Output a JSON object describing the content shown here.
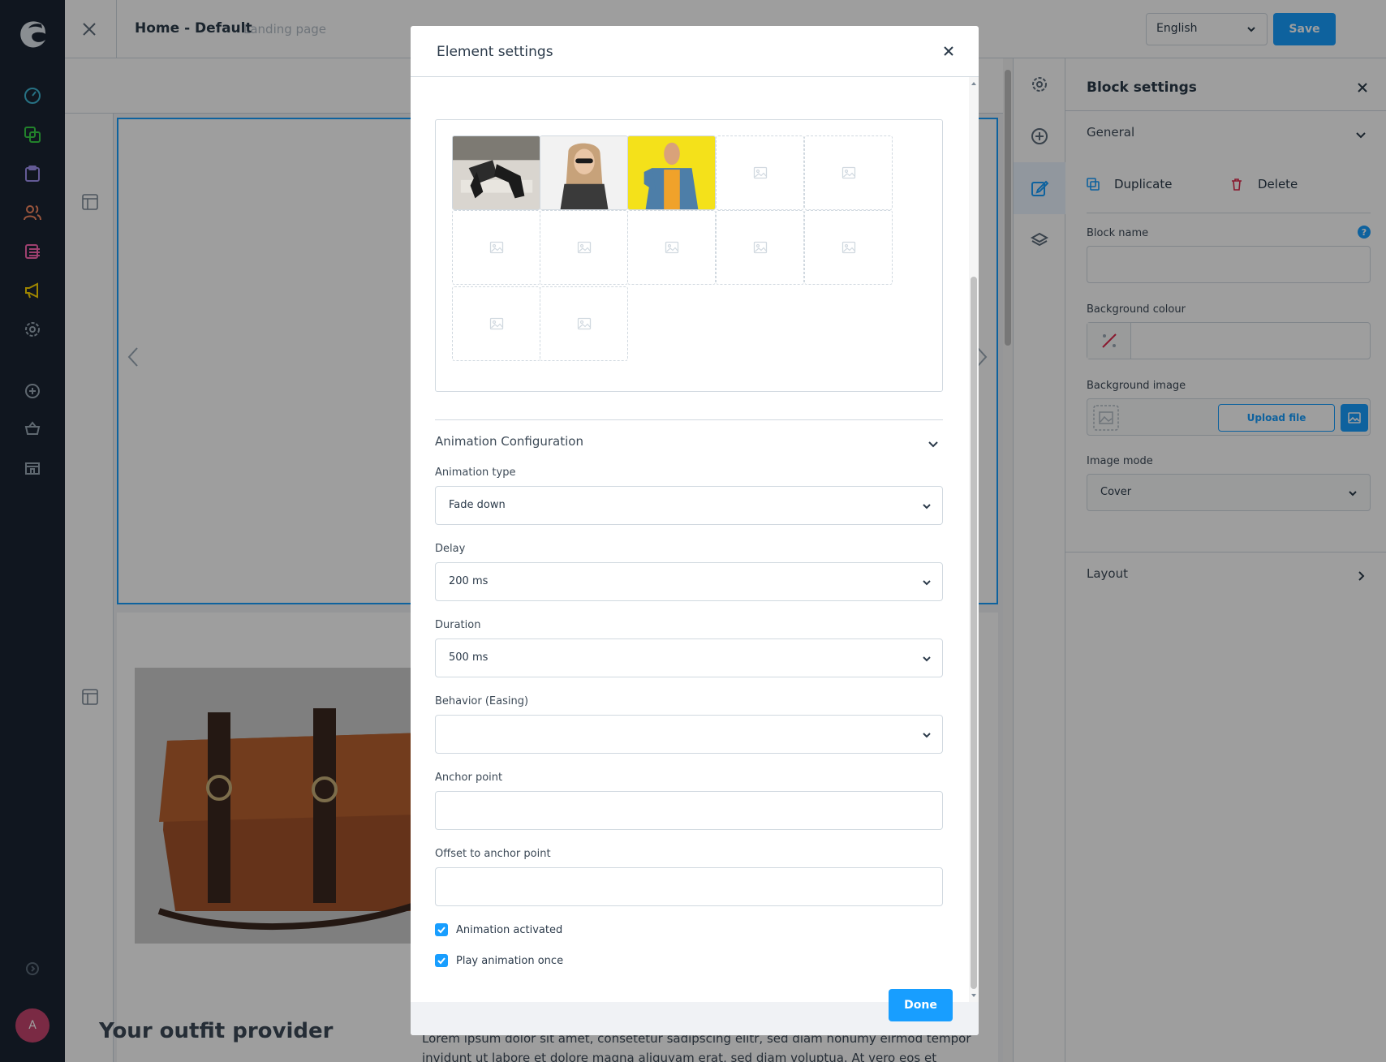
{
  "header": {
    "page_title": "Home - Default",
    "page_type": "Landing page",
    "language": "English",
    "save_label": "Save"
  },
  "sidebar": {
    "avatar_initial": "A",
    "icons": [
      "dashboard-icon",
      "catalogue-icon",
      "orders-icon",
      "customers-icon",
      "content-icon",
      "marketing-icon",
      "settings-icon",
      "add-icon",
      "basket-icon",
      "store-icon",
      "help-icon"
    ]
  },
  "canvas": {
    "heading": "Your outfit provider",
    "paragraph": "Lorem ipsum dolor sit amet, consetetur sadipscing elitr, sed diam nonumy eirmod tempor invidunt ut labore et dolore magna aliquyam erat, sed diam voluptua. At vero eos et accusam et justo duo"
  },
  "block_settings": {
    "title": "Block settings",
    "general_label": "General",
    "duplicate_label": "Duplicate",
    "delete_label": "Delete",
    "block_name_label": "Block name",
    "block_name_value": "",
    "background_colour_label": "Background colour",
    "background_image_label": "Background image",
    "upload_label": "Upload file",
    "image_mode_label": "Image mode",
    "image_mode_value": "Cover",
    "layout_label": "Layout"
  },
  "modal": {
    "title": "Element settings",
    "gallery": {
      "slots": [
        {
          "filled": true,
          "name": "boots-image"
        },
        {
          "filled": true,
          "name": "sunglasses-woman-image"
        },
        {
          "filled": true,
          "name": "yellow-jacket-image"
        },
        {
          "filled": false
        },
        {
          "filled": false
        },
        {
          "filled": false
        },
        {
          "filled": false
        },
        {
          "filled": false
        },
        {
          "filled": false
        },
        {
          "filled": false
        },
        {
          "filled": false
        },
        {
          "filled": false
        }
      ]
    },
    "animation_section_label": "Animation Configuration",
    "animation_type_label": "Animation type",
    "animation_type_value": "Fade down",
    "delay_label": "Delay",
    "delay_value": "200 ms",
    "duration_label": "Duration",
    "duration_value": "500 ms",
    "easing_label": "Behavior (Easing)",
    "easing_value": "",
    "anchor_label": "Anchor point",
    "anchor_value": "",
    "offset_label": "Offset to anchor point",
    "offset_value": "",
    "animation_activated_label": "Animation activated",
    "animation_activated": true,
    "play_once_label": "Play animation once",
    "play_once": true,
    "done_label": "Done"
  },
  "colors": {
    "accent": "#189eff",
    "sidebar_bg": "#1a2533",
    "avatar": "#c5446e"
  }
}
